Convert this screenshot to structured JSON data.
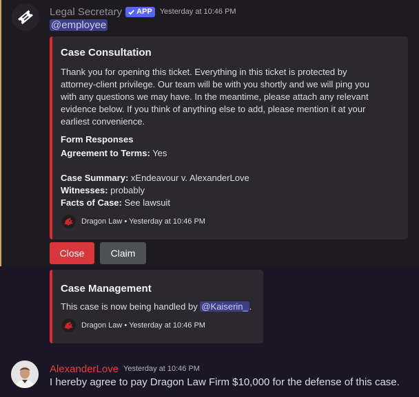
{
  "bot_message": {
    "username": "Legal Secretary",
    "app_badge": "APP",
    "timestamp": "Yesterday at 10:46 PM",
    "mention": "@employee",
    "colors": {
      "highlight": "#c7a46a",
      "embed_accent": "#da2c34",
      "badge": "#5865f2"
    }
  },
  "consultation_embed": {
    "title": "Case Consultation",
    "description": "Thank you for opening this ticket. Everything in this ticket is protected by attorney-client privilege. Our team will be with you shortly and we will ping you with any questions we may have. In the meantime, please attach any relevant evidence below. If you think of anything else to add, please mention it at your earliest convenience.",
    "fields_title": "Form Responses",
    "fields": [
      {
        "name": "Agreement to Terms:",
        "value": "Yes"
      },
      {
        "name": "Case Summary:",
        "value": "xEndeavour v. AlexanderLove"
      },
      {
        "name": "Witnesses:",
        "value": "probably"
      },
      {
        "name": "Facts of Case:",
        "value": "See lawsuit"
      }
    ],
    "footer": "Dragon Law • Yesterday at 10:46 PM",
    "footer_icon": "dragon-logo-icon"
  },
  "buttons": {
    "close_label": "Close",
    "claim_label": "Claim"
  },
  "management_embed": {
    "title": "Case Management",
    "text": "This case is now being handled by",
    "mention": "@Kaiserin_",
    "text_end": ".",
    "footer": "Dragon Law • Yesterday at 10:46 PM",
    "footer_icon": "dragon-logo-icon"
  },
  "user_message": {
    "username": "AlexanderLove",
    "timestamp": "Yesterday at 10:46 PM",
    "text": "I hereby agree to pay Dragon Law Firm $10,000 for the defense of this case.",
    "username_color": "#e0403d"
  }
}
